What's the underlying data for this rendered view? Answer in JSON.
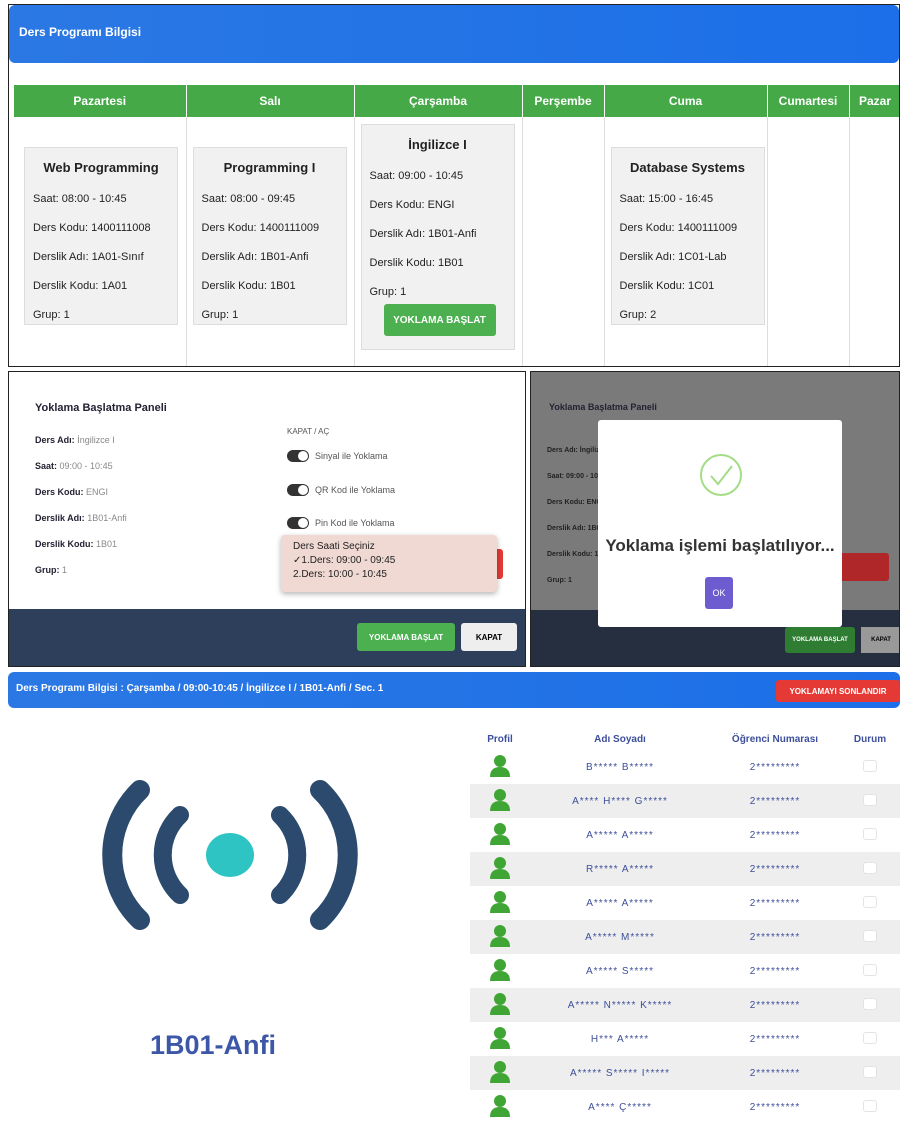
{
  "schedule": {
    "header": "Ders Programı Bilgisi",
    "days": [
      "Pazartesi",
      "Salı",
      "Çarşamba",
      "Perşembe",
      "Cuma",
      "Cumartesi",
      "Pazar"
    ],
    "cards": [
      {
        "title": "Web Programming",
        "lines": [
          "Saat: 08:00 - 10:45",
          "Ders Kodu: 1400111008",
          "Derslik Adı: 1A01-Sınıf",
          "Derslik Kodu: 1A01",
          "Grup: 1"
        ]
      },
      {
        "title": "Programming I",
        "lines": [
          "Saat: 08:00 - 09:45",
          "Ders Kodu: 1400111009",
          "Derslik Adı: 1B01-Anfi",
          "Derslik Kodu: 1B01",
          "Grup: 1"
        ]
      },
      {
        "title": "İngilizce I",
        "lines": [
          "Saat: 09:00 - 10:45",
          "Ders Kodu: ENGI",
          "Derslik Adı: 1B01-Anfi",
          "Derslik Kodu: 1B01",
          "Grup: 1"
        ],
        "button": "YOKLAMA BAŞLAT"
      },
      {
        "title": "Database Systems",
        "lines": [
          "Saat: 15:00 - 16:45",
          "Ders Kodu: 1400111009",
          "Derslik Adı: 1C01-Lab",
          "Derslik Kodu: 1C01",
          "Grup: 2"
        ]
      }
    ]
  },
  "panel": {
    "title": "Yoklama Başlatma Paneli",
    "info": [
      {
        "k": "Ders Adı:",
        "v": "İngilizce I"
      },
      {
        "k": "Saat:",
        "v": "09:00 - 10:45"
      },
      {
        "k": "Ders Kodu:",
        "v": "ENGI"
      },
      {
        "k": "Derslik Adı:",
        "v": "1B01-Anfi"
      },
      {
        "k": "Derslik Kodu:",
        "v": "1B01"
      },
      {
        "k": "Grup:",
        "v": "1"
      }
    ],
    "toggle_header": "KAPAT / AÇ",
    "toggles": [
      "Sinyal ile Yoklama",
      "QR Kod ile Yoklama",
      "Pin Kod ile Yoklama"
    ],
    "dropdown": {
      "title": "Ders Saati Seçiniz",
      "options": [
        "✓1.Ders: 09:00 - 09:45",
        "2.Ders: 10:00 - 10:45"
      ]
    },
    "start_button": "YOKLAMA BAŞLAT",
    "close_button": "KAPAT"
  },
  "modal_screen": {
    "title": "Yoklama Başlatma Paneli",
    "labels": [
      "Ders Adı: İngiliz",
      "Saat: 09:00 - 10",
      "Ders Kodu: ENGI",
      "Derslik Adı: 1B01",
      "Derslik Kodu: 1B",
      "Grup: 1"
    ],
    "message": "Yoklama işlemi başlatılıyor...",
    "ok": "OK",
    "start_button": "YOKLAMA BAŞLAT",
    "close_button": "KAPAT"
  },
  "attendance": {
    "header": "Ders Programı Bilgisi : Çarşamba / 09:00-10:45 / İngilizce I / 1B01-Anfi / Sec. 1",
    "end_button": "YOKLAMAYI SONLANDIR",
    "room": "1B01-Anfi",
    "columns": [
      "Profil",
      "Adı Soyadı",
      "Öğrenci Numarası",
      "Durum"
    ],
    "rows": [
      {
        "name": "B***** B*****",
        "no": "2*********"
      },
      {
        "name": "A**** H**** G*****",
        "no": "2*********"
      },
      {
        "name": "A***** A*****",
        "no": "2*********"
      },
      {
        "name": "R***** A*****",
        "no": "2*********"
      },
      {
        "name": "A***** A*****",
        "no": "2*********"
      },
      {
        "name": "A***** M*****",
        "no": "2*********"
      },
      {
        "name": "A***** S*****",
        "no": "2*********"
      },
      {
        "name": "A***** N***** K*****",
        "no": "2*********"
      },
      {
        "name": "H*** A*****",
        "no": "2*********"
      },
      {
        "name": "A***** S***** I*****",
        "no": "2*********"
      },
      {
        "name": "A**** Ç*****",
        "no": "2*********"
      }
    ]
  }
}
